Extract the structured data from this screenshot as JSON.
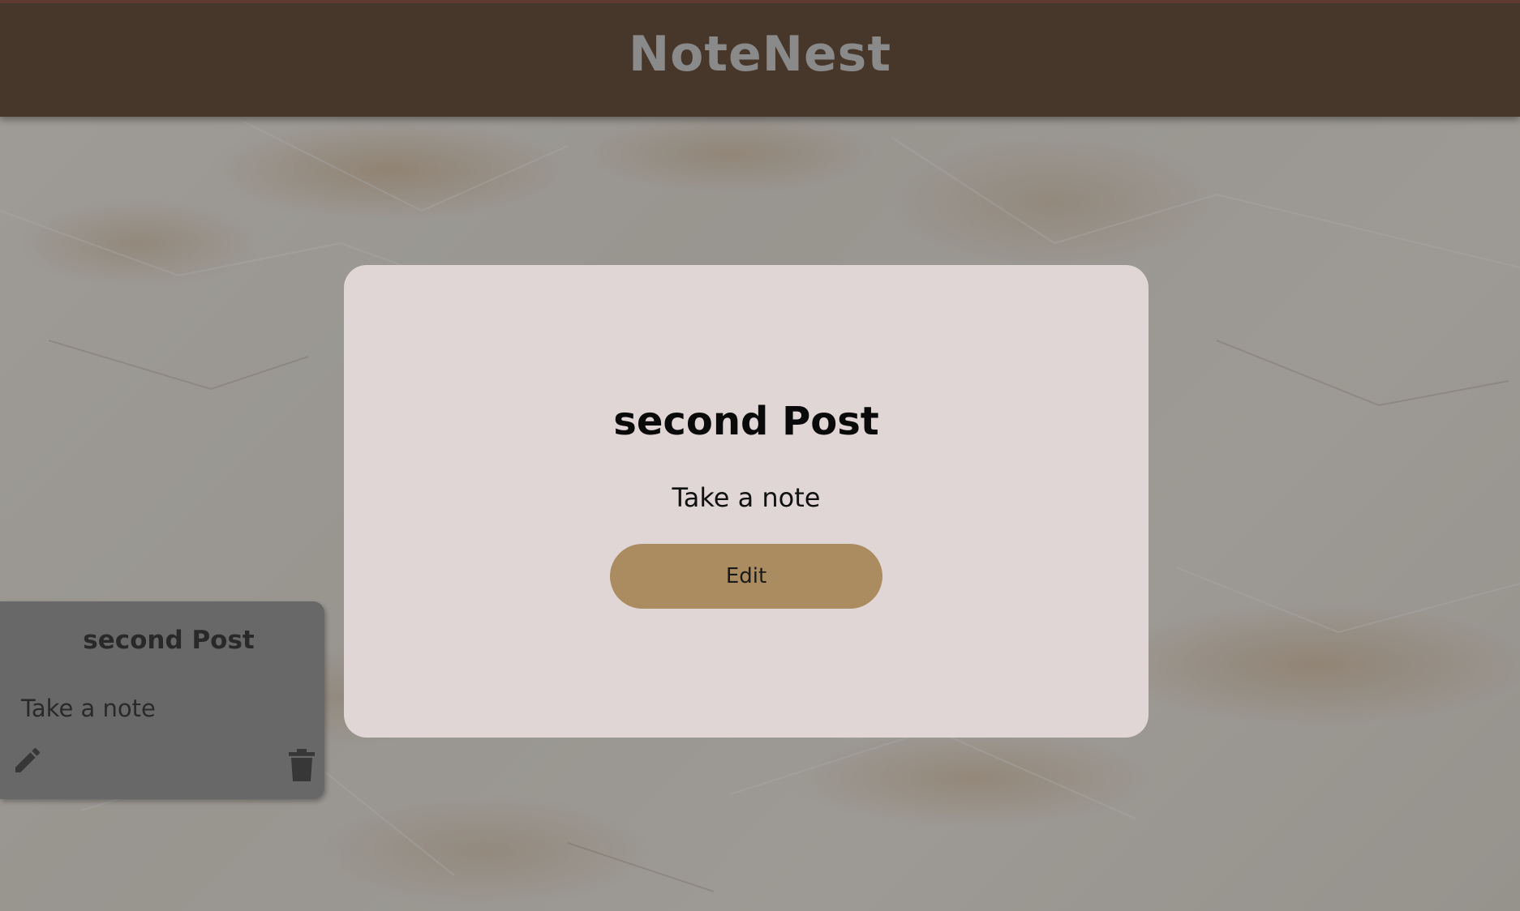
{
  "header": {
    "title": "NoteNest"
  },
  "notes": [
    {
      "title": "second Post",
      "body": "Take a note",
      "edit_icon": "pencil-icon",
      "delete_icon": "trash-icon"
    }
  ],
  "modal": {
    "title": "second Post",
    "body": "Take a note",
    "edit_label": "Edit"
  },
  "colors": {
    "header_bg": "#47372a",
    "title_text": "#8a8a8a",
    "modal_bg": "#e0d6d6",
    "button_bg": "#ab8c61",
    "card_bg": "#848484"
  }
}
